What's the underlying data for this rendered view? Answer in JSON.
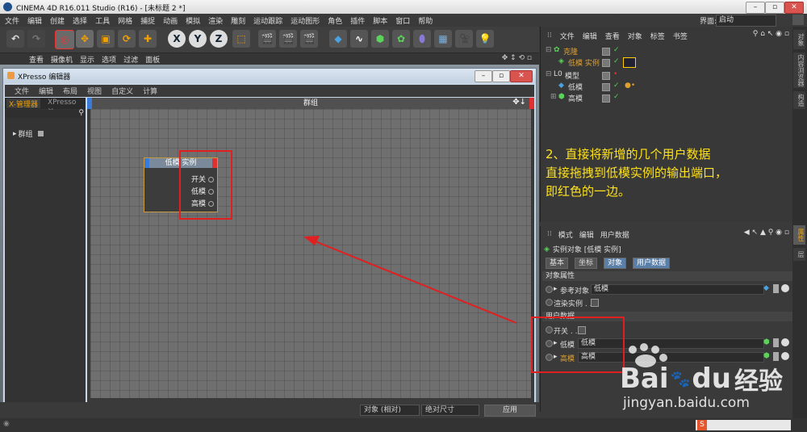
{
  "app": {
    "title": "CINEMA 4D R16.011 Studio (R16) - [未标题 2 *]",
    "menus": [
      "文件",
      "编辑",
      "创建",
      "选择",
      "工具",
      "网格",
      "捕捉",
      "动画",
      "模拟",
      "渲染",
      "雕刻",
      "运动跟踪",
      "运动图形",
      "角色",
      "插件",
      "脚本",
      "窗口",
      "帮助"
    ],
    "layout_label": "界面:",
    "layout_value": "启动"
  },
  "toolbar": {
    "axis_x": "X",
    "axis_y": "Y",
    "axis_z": "Z"
  },
  "viewport_menu": [
    "查看",
    "摄像机",
    "显示",
    "选项",
    "过滤",
    "面板"
  ],
  "xpresso": {
    "title": "XPresso 编辑器",
    "menu": [
      "文件",
      "编辑",
      "布局",
      "视图",
      "自定义",
      "计算"
    ],
    "tabs": [
      "X-管理器",
      "XPresso 池"
    ],
    "tree_item": "群组",
    "header": "群组",
    "node": {
      "title": "低模 实例",
      "ports": [
        "开关",
        "低模",
        "高模"
      ]
    }
  },
  "bottom": {
    "coord_select": "对象 (相对)",
    "size_select": "绝对尺寸",
    "apply": "应用"
  },
  "objects": {
    "menu": [
      "文件",
      "编辑",
      "查看",
      "对象",
      "标签",
      "书签"
    ],
    "rows": [
      {
        "name": "克隆",
        "color": "#e0a030"
      },
      {
        "name": "低模 实例",
        "color": "#e0a030"
      },
      {
        "name": "模型",
        "color": "#dddddd"
      },
      {
        "name": "低模",
        "color": "#dddddd"
      },
      {
        "name": "高模",
        "color": "#dddddd"
      }
    ]
  },
  "note": {
    "lines": [
      "2、直接将新增的几个用户数据",
      "直接拖拽到低模实例的输出端口，",
      "即红色的一边。"
    ]
  },
  "attributes": {
    "menu": [
      "模式",
      "编辑",
      "用户数据"
    ],
    "object_title": "实例对象 [低模 实例]",
    "tabs": [
      "基本",
      "坐标",
      "对象",
      "用户数据"
    ],
    "section_object": "对象属性",
    "ref_label": "参考对象",
    "ref_value": "低模",
    "render_label": "渲染实例 . .",
    "section_user": "用户数据",
    "switch_label": "开关 . . .",
    "low_label": "低模",
    "low_value": "低模",
    "high_label": "高模",
    "high_value": "高模"
  },
  "side_tabs": [
    "对象",
    "内容浏览器",
    "构造",
    "属性",
    "层"
  ],
  "watermark": {
    "brand": "Bai",
    "brand2": "du",
    "cn": "经验",
    "url": "jingyan.baidu.com"
  }
}
